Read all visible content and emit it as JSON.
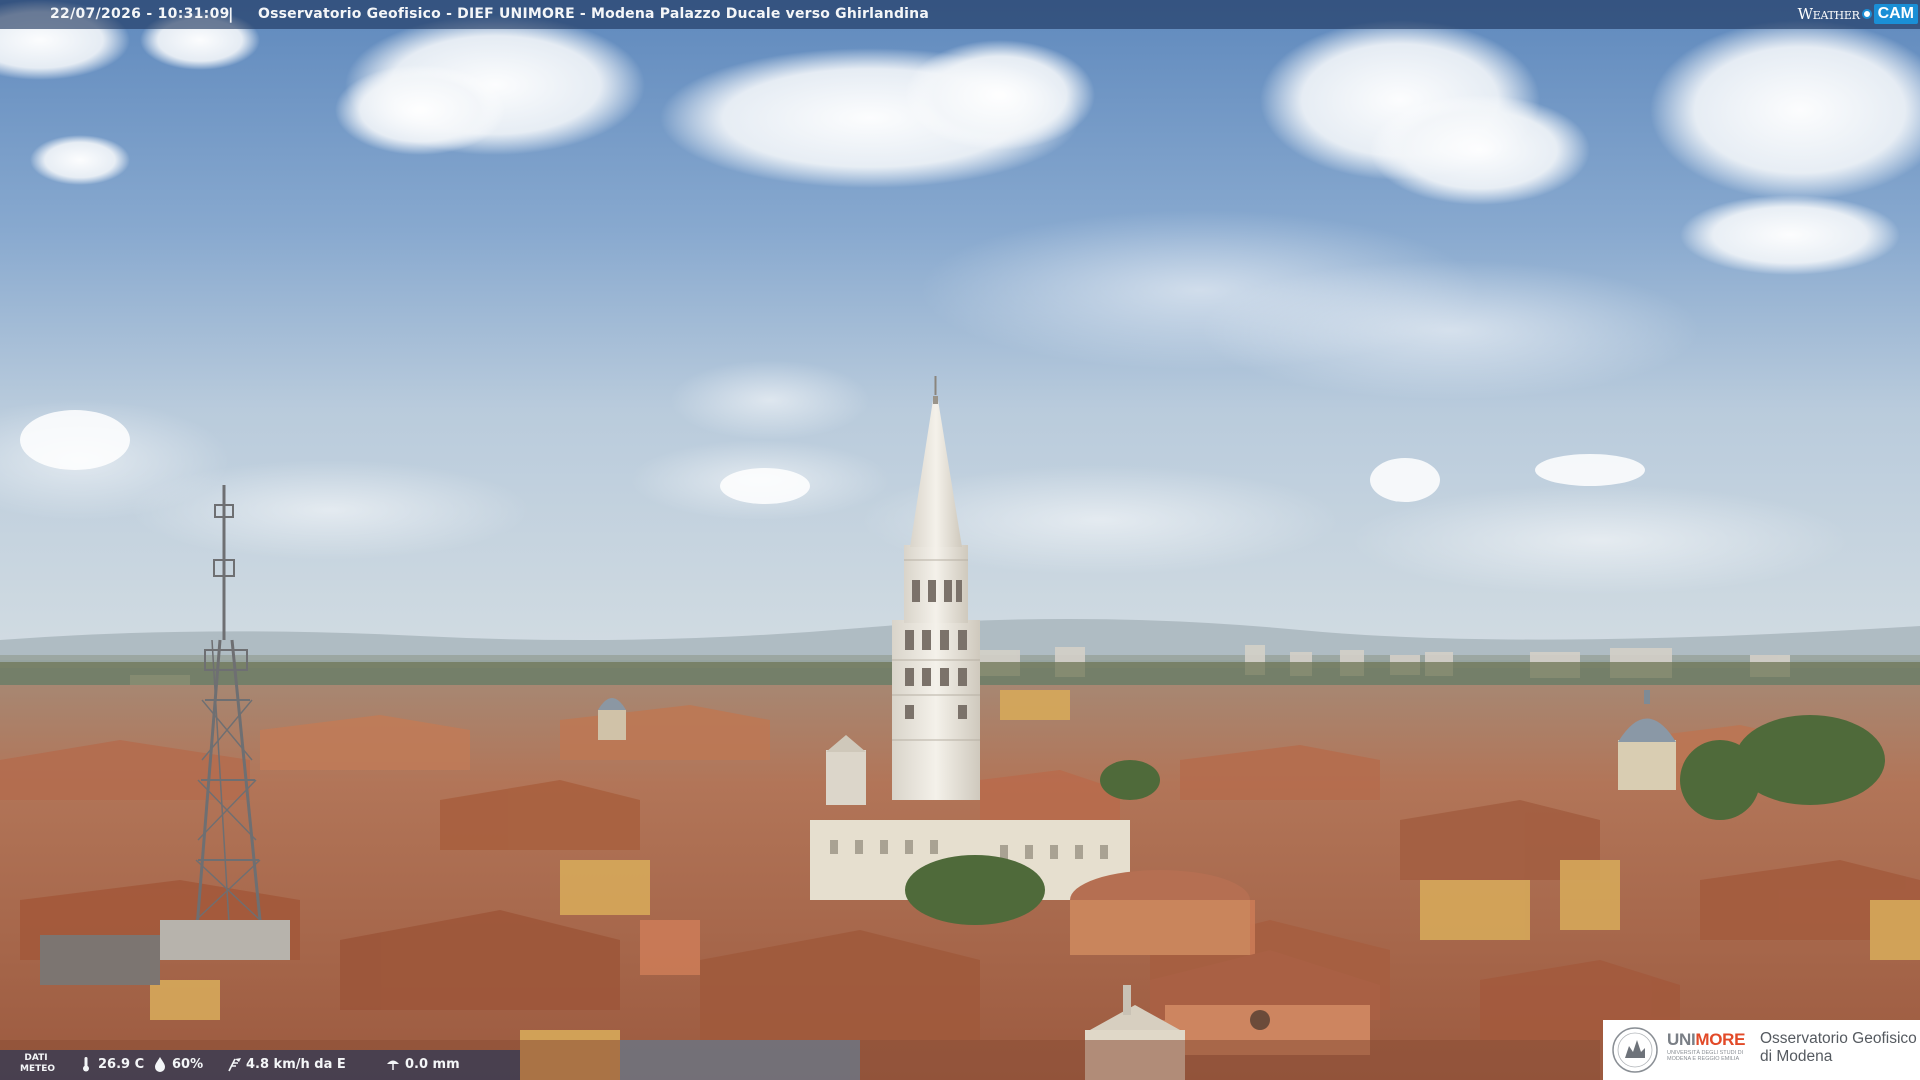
{
  "overlay": {
    "datetime": "22/07/2026 - 10:31:09",
    "separator": "|",
    "caption": "Osservatorio Geofisico - DIEF UNIMORE - Modena Palazzo Ducale verso Ghirlandina"
  },
  "brand": {
    "weather_text": "Weather",
    "cam_text": "CAM"
  },
  "weather": {
    "label_line1": "DATI",
    "label_line2": "METEO",
    "temperature": "26.9 C",
    "humidity": "60%",
    "wind": "4.8 km/h da E",
    "rain": "0.0 mm",
    "icons": [
      "thermometer-icon",
      "humidity-drop-icon",
      "wind-icon",
      "rain-icon"
    ]
  },
  "logo": {
    "uni": "UNI",
    "more": "MORE",
    "uni_subtitle": "UNIVERSITÀ DEGLI STUDI DI MODENA E REGGIO EMILIA",
    "obs_line1": "Osservatorio Geofisico",
    "obs_line2": "di Modena"
  },
  "colors": {
    "sky_top": "#6e95c4",
    "sky_horizon": "#c7d6e2",
    "roof": "#b86f4f",
    "ghirlandina": "#eeeae2",
    "bar_overlay": "#1c345c",
    "weathercam_blue": "#1a8fd6",
    "unimore_orange": "#e24a28"
  }
}
